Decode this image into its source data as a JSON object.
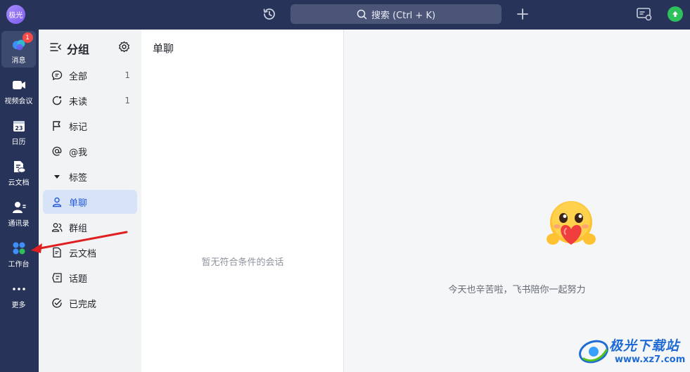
{
  "topbar": {
    "avatar_text": "极光",
    "search_placeholder": "搜索 (Ctrl + K)"
  },
  "leftnav": {
    "items": [
      {
        "label": "消息",
        "badge": "1",
        "icon": "message-icon"
      },
      {
        "label": "视频会议",
        "icon": "video-icon"
      },
      {
        "label": "日历",
        "icon": "calendar-icon",
        "day": "23"
      },
      {
        "label": "云文档",
        "icon": "cloud-doc-icon"
      },
      {
        "label": "通讯录",
        "icon": "contacts-icon"
      },
      {
        "label": "工作台",
        "icon": "workplace-icon"
      },
      {
        "label": "更多",
        "icon": "more-icon"
      }
    ]
  },
  "groups": {
    "title": "分组",
    "items": [
      {
        "label": "全部",
        "count": "1",
        "icon": "chat-bubble-icon"
      },
      {
        "label": "未读",
        "count": "1",
        "icon": "unread-icon"
      },
      {
        "label": "标记",
        "count": "",
        "icon": "flag-icon"
      },
      {
        "label": "@我",
        "count": "",
        "icon": "at-icon"
      },
      {
        "label": "标签",
        "count": "",
        "icon": "caret-down-icon"
      },
      {
        "label": "单聊",
        "count": "",
        "icon": "person-icon"
      },
      {
        "label": "群组",
        "count": "",
        "icon": "group-icon"
      },
      {
        "label": "云文档",
        "count": "",
        "icon": "doc-icon"
      },
      {
        "label": "话题",
        "count": "",
        "icon": "topic-icon"
      },
      {
        "label": "已完成",
        "count": "",
        "icon": "check-circle-icon"
      }
    ]
  },
  "chatlist": {
    "title": "单聊",
    "empty_text": "暂无符合条件的会话"
  },
  "rightpane": {
    "slogan": "今天也辛苦啦，飞书陪你一起努力"
  },
  "watermark": {
    "title": "极光下载站",
    "url": "www.xz7.com"
  },
  "colors": {
    "sidebar": "#273358",
    "accent": "#245bdb",
    "active_bg": "#d7e3f7",
    "badge": "#f54a45",
    "upgrade": "#2ec05c"
  }
}
